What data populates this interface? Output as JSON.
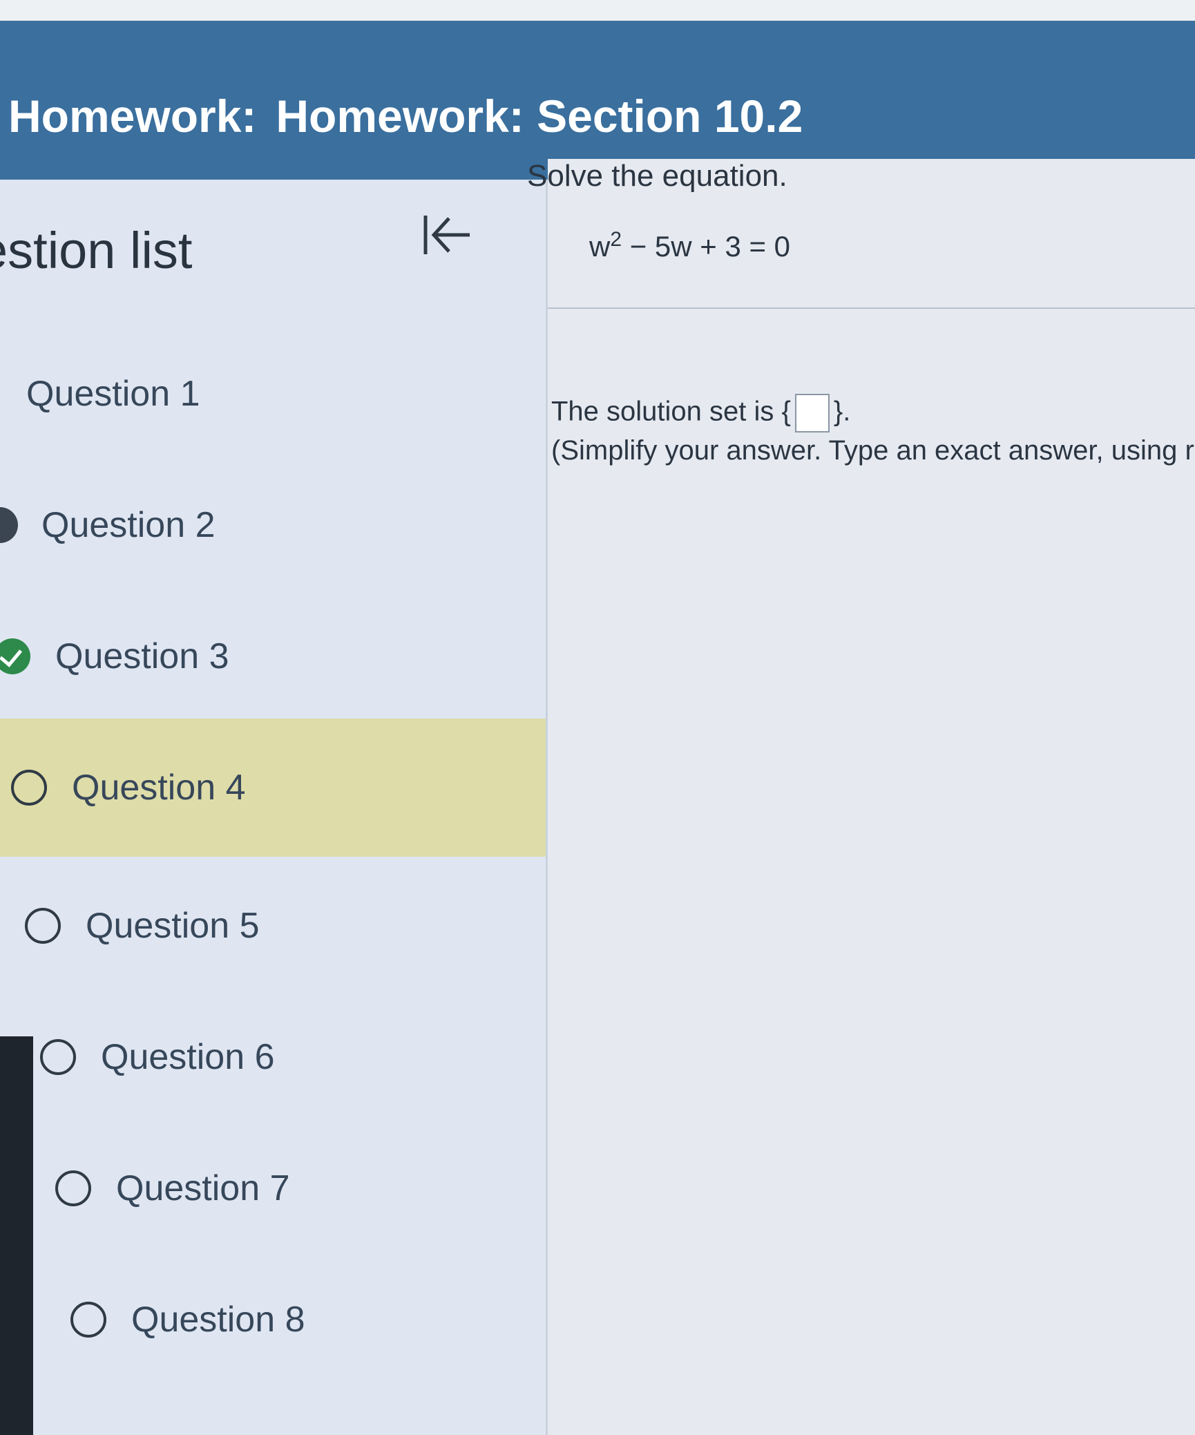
{
  "header": {
    "prefix": "Homework:",
    "title": "Homework: Section 10.2"
  },
  "sidebar": {
    "title": "estion list",
    "collapse_icon": "collapse-left-icon",
    "items": [
      {
        "label": "Question 1",
        "status": "unknown"
      },
      {
        "label": "Question 2",
        "status": "partial"
      },
      {
        "label": "Question 3",
        "status": "done"
      },
      {
        "label": "Question 4",
        "status": "empty",
        "active": true
      },
      {
        "label": "Question 5",
        "status": "empty"
      },
      {
        "label": "Question 6",
        "status": "empty"
      },
      {
        "label": "Question 7",
        "status": "empty"
      },
      {
        "label": "Question 8",
        "status": "empty"
      }
    ]
  },
  "problem": {
    "prompt": "Solve the equation.",
    "equation_base": "w",
    "equation_exp": "2",
    "equation_rest": " − 5w + 3 = 0",
    "solution_prefix": "The solution set is ",
    "brace_open": "{",
    "brace_close": "}",
    "period": ".",
    "instructions": "(Simplify your answer. Type an exact answer, using ra"
  },
  "colors": {
    "header_bg": "#3a6f9e",
    "active_item_bg": "#dedca8",
    "done_status": "#2d8a4a"
  }
}
